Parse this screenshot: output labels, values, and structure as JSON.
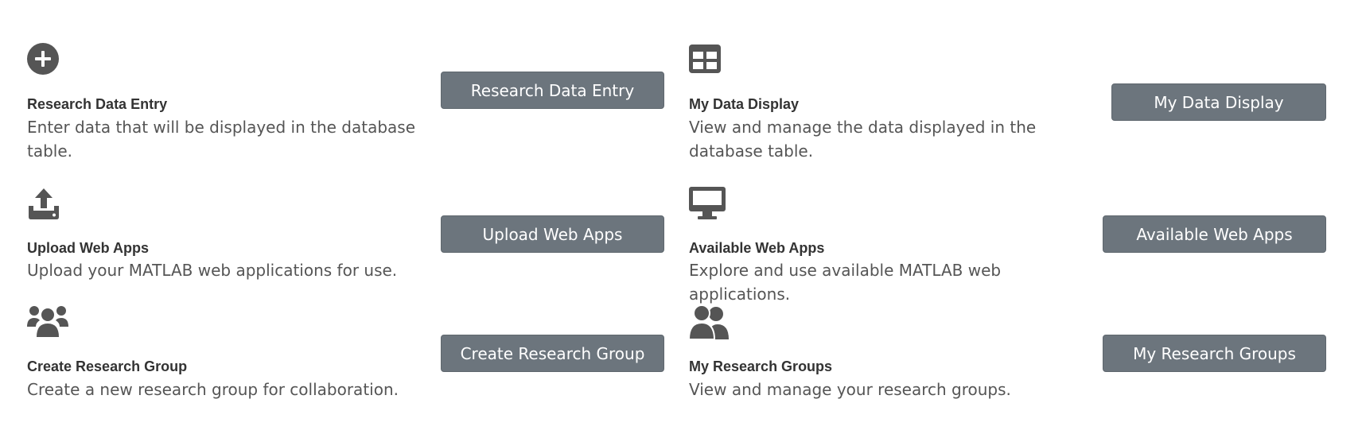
{
  "colors": {
    "button_bg": "#6c757d",
    "button_text": "#ffffff",
    "icon": "#555555",
    "title": "#333333",
    "description": "#555555"
  },
  "cards": [
    {
      "icon": "plus-circle-icon",
      "title": "Research Data Entry",
      "description": "Enter data that will be displayed in the database table.",
      "button_label": "Research Data Entry"
    },
    {
      "icon": "table-icon",
      "title": "My Data Display",
      "description": "View and manage the data displayed in the database table.",
      "button_label": "My Data Display"
    },
    {
      "icon": "upload-icon",
      "title": "Upload Web Apps",
      "description": "Upload your MATLAB web applications for use.",
      "button_label": "Upload Web Apps"
    },
    {
      "icon": "desktop-icon",
      "title": "Available Web Apps",
      "description": "Explore and use available MATLAB web applications.",
      "button_label": "Available Web Apps"
    },
    {
      "icon": "users-icon",
      "title": "Create Research Group",
      "description": "Create a new research group for collaboration.",
      "button_label": "Create Research Group"
    },
    {
      "icon": "user-friends-icon",
      "title": "My Research Groups",
      "description": "View and manage your research groups.",
      "button_label": "My Research Groups"
    }
  ]
}
